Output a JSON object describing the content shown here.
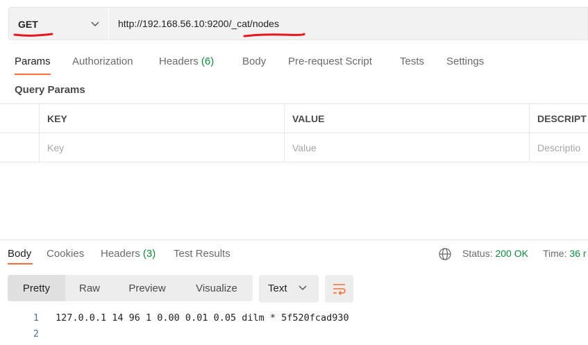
{
  "request": {
    "method": "GET",
    "url": "http://192.168.56.10:9200/_cat/nodes"
  },
  "request_tabs": [
    {
      "label": "Params",
      "count": ""
    },
    {
      "label": "Authorization",
      "count": ""
    },
    {
      "label": "Headers",
      "count": "(6)"
    },
    {
      "label": "Body",
      "count": ""
    },
    {
      "label": "Pre-request Script",
      "count": ""
    },
    {
      "label": "Tests",
      "count": ""
    },
    {
      "label": "Settings",
      "count": ""
    }
  ],
  "query_params": {
    "title": "Query Params",
    "headers": [
      "KEY",
      "VALUE",
      "DESCRIPT"
    ],
    "placeholders": [
      "Key",
      "Value",
      "Descriptio"
    ]
  },
  "response_tabs": [
    {
      "label": "Body",
      "count": ""
    },
    {
      "label": "Cookies",
      "count": ""
    },
    {
      "label": "Headers",
      "count": "(3)"
    },
    {
      "label": "Test Results",
      "count": ""
    }
  ],
  "status": {
    "label": "Status:",
    "value": "200 OK",
    "time_label": "Time:",
    "time_value": "36 r"
  },
  "view_modes": [
    "Pretty",
    "Raw",
    "Preview",
    "Visualize"
  ],
  "format": "Text",
  "code_lines": [
    {
      "num": "1",
      "text": "127.0.0.1 14 96 1 0.00 0.01 0.05 dilm * 5f520fcad930"
    },
    {
      "num": "2",
      "text": ""
    }
  ],
  "colors": {
    "accent": "#ff6c37",
    "success": "#0f8a3c",
    "annotation": "#e8151d"
  }
}
